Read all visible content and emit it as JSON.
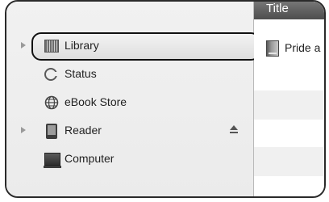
{
  "sidebar": {
    "items": [
      {
        "label": "Library",
        "icon": "library-icon",
        "expandable": true,
        "selected": true
      },
      {
        "label": "Status",
        "icon": "status-icon",
        "expandable": false
      },
      {
        "label": "eBook Store",
        "icon": "globe-icon",
        "expandable": false
      },
      {
        "label": "Reader",
        "icon": "reader-device-icon",
        "expandable": true,
        "ejectable": true
      },
      {
        "label": "Computer",
        "icon": "computer-icon",
        "expandable": false
      }
    ]
  },
  "content": {
    "column_header": "Title",
    "rows": [
      {
        "title": "Pride a"
      }
    ]
  }
}
